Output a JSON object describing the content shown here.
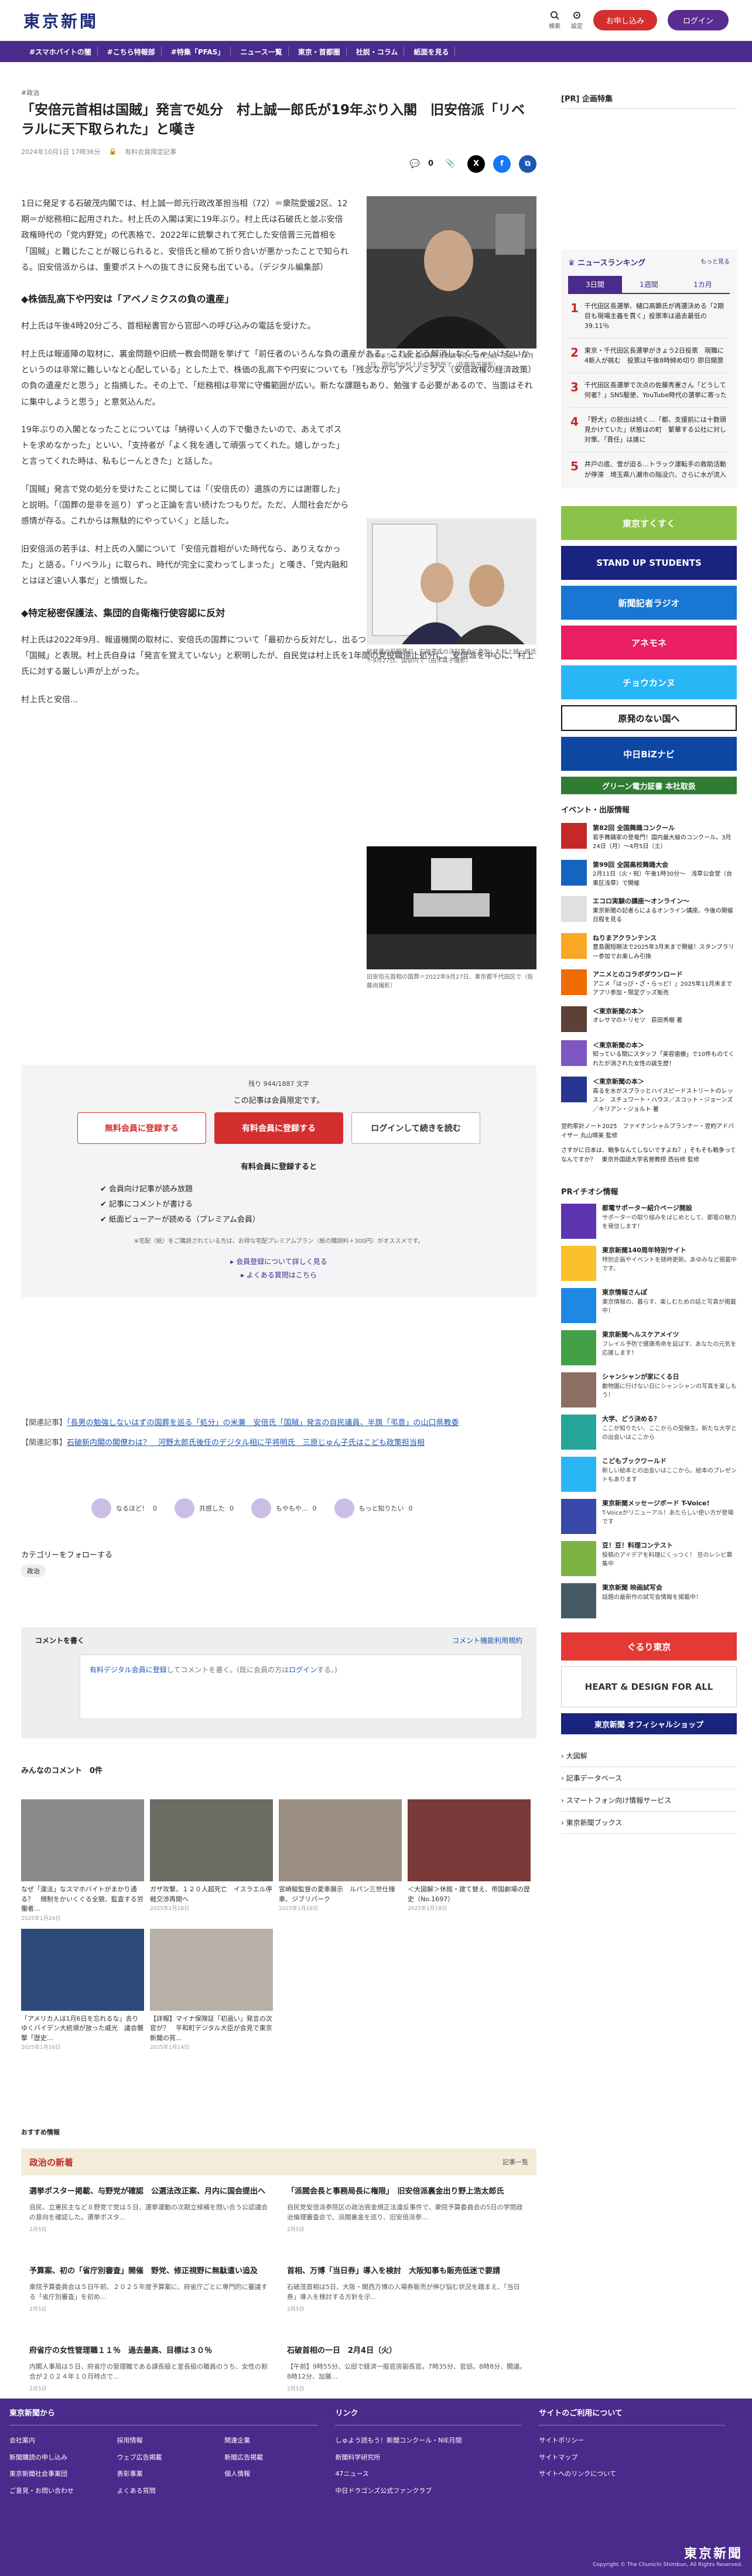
{
  "header": {
    "logo": "東京新聞",
    "search_label": "検索",
    "settings_label": "設定",
    "register_label": "お申し込み",
    "login_label": "ログイン"
  },
  "nav": [
    "#スマホバイトの闇",
    "#こちら特報部",
    "#特集「PFAS」",
    "ニュース一覧",
    "東京・首都圏",
    "社説・コラム",
    "紙面を見る"
  ],
  "article": {
    "category": "#政治",
    "title": "「安倍元首相は国賊」発言で処分　村上誠一郎氏が19年ぶり入閣　旧安倍派「リベラルに天下取られた」と嘆き",
    "date": "2024年10月1日 17時36分",
    "badge": "有料会員限定記事",
    "comment_count": "0",
    "p1": "1日に発足する石破茂内閣では、村上誠一郎元行政改革担当相（72）＝衆院愛媛2区、12期＝が総務相に起用された。村上氏の入閣は実に19年ぶり。村上氏は石破氏と並ぶ安倍政権時代の「党内野党」の代表格で、2022年に銃撃されて死亡した安倍晋三元首相を「国賊」と難じたことが報じられると、安倍氏と極めて折り合いが悪かったことで知られる。旧安倍派からは、重要ポストへの抜てきに反発も出ている。（デジタル編集部）",
    "h1": "◆株価乱高下や円安は「アベノミクスの負の遺産」",
    "p2": "村上氏は午後4時20分ごろ、首相秘書官から官邸への呼び込みの電話を受けた。",
    "p3": "村上氏は報道陣の取材に、裏金問題や旧統一教会問題を挙げて「前任者のいろんな負の遺産がある。これをどう解消しなくちゃいけないかというのは非常に難しいなと心配している」とした上で、株価の乱高下や円安についても「残念ながらアベノミクス（安倍政権の経済政策）の負の遺産だと思う」と指摘した。その上で、「総務相は非常に守備範囲が広い。新たな課題もあり、勉強する必要があるので、当面はそれに集中しようと思う」と意気込んだ。",
    "p4": "19年ぶりの入閣となったことについては「納得いく人の下で働きたいので、あえてポストを求めなかった」といい、「支持者が「よく我を通して頑張ってくれた。嬉しかった」と言ってくれた時は、私もじーんときた」と話した。",
    "p5": "「国賊」発言で党の処分を受けたことに関しては「（安倍氏の）遺族の方には謝罪した」と説明。「（国葬の是非を巡り）ずっと正論を言い続けたつもりだ。ただ、人間社会だから感情が存る。これからは無駄的にやっていく」と話した。",
    "p6": "旧安倍派の若手は、村上氏の入閣について「安倍元首相がいた時代なら、ありえなかった」と語る。「リベラル」に取られ、時代が完全に変わってしまった」と嘆き、「党内融和とはほど遠い人事だ」と憤慨した。",
    "h2": "◆特定秘密保護法、集団的自衛権行使容認に反対",
    "p7": "村上氏は2022年9月、報道機関の取材に、安倍氏の国葬について「最初から反対だし、出るつもりもない」との考えを示した際、安倍氏を「国賊」と表現。村上氏自身は「発言を覚えていない」と釈明したが、自民党は村上氏を1年間の党役職停止処分に。安倍派を中心に、村上氏に対する厳しい声が上がった。",
    "p8": "村上氏と安倍...",
    "fig1_cap": "19年ぶりの入閣に感慨深った表情を見せる村上誠一郎氏＝10月1日、国会内の村上氏の事務所で（佐藤哉平撮影）",
    "fig2_cap": "総裁選の投開票日、石破茂氏の決起集会に参加した村上誠一郎氏＝9月27日、国会内で（由木真子撮影）",
    "fig3_cap": "旧安倍元首相の国葬＝2022年9月27日、東京都千代田区で（佐藤尚撮影）"
  },
  "paywall": {
    "remaining": "残り 944/1887 文字",
    "lead": "この記事は会員限定です。",
    "btn_free": "無料会員に登録する",
    "btn_paid": "有料会員に登録する",
    "btn_login": "ログインして続きを読む",
    "subhead": "有料会員に登録すると",
    "benefits": [
      "会員向け記事が読み放題",
      "記事にコメントが書ける",
      "紙面ビューアーが読める（プレミアム会員）"
    ],
    "note": "※宅配（紙）をご購読されている方は、お得な宅配プレミアムプラン（紙の購読料＋300円）がオススメです。",
    "link1": "会員登録について詳しく見る",
    "link2": "よくある質問はこちら"
  },
  "related": [
    {
      "label": "【関連記事】",
      "text": "「長男の勉強しないはずの国葬を巡る「処分」の米兼　安倍氏「国賊」発言の自民議員、半旗「弔意」の山口県教委"
    },
    {
      "label": "【関連記事】",
      "text": "石破新内閣の閣僚わは？　河野太郎氏後任のデジタル相に平将明氏　三原じゅん子氏はこども政策担当相"
    }
  ],
  "reactions": [
    "なるほど！",
    "共感した",
    "もやもや...",
    "もっと知りたい"
  ],
  "reaction_counts": [
    "0",
    "0",
    "0",
    "0"
  ],
  "follow": {
    "label": "カテゴリーをフォローする",
    "chip": "政治"
  },
  "comment": {
    "title": "コメントを書く",
    "rule": "コメント機能利用規約",
    "prompt_link": "有料デジタル会員に登録",
    "prompt": "してコメントを書く。(既に会員の方は",
    "login": "ログイン",
    "prompt_end": "する。)"
  },
  "comments_title": "みんなのコメント　0件",
  "thumbs": [
    {
      "cap": "なぜ「違法」なスマホバイトがまかり通る？　規制をかいくぐる全貌、監査する労働者...",
      "date": "2025年1月24日"
    },
    {
      "cap": "ガザ攻撃、１２０人超死亡　イスラエル停戦交渉再開へ",
      "date": "2025年1月18日"
    },
    {
      "cap": "宮崎駿監督の愛車展示　ルパン三世仕様車、ジブリパーク",
      "date": "2025年1月16日"
    },
    {
      "cap": "＜大図解＞休館・建て替え、帝国劇場の歴史（No.1697）",
      "date": "2025年1月18日"
    },
    {
      "cap": "「アメリカ人は1月6日を忘れるな」去りゆくバイデン大統領が放った威光　議会襲撃「歴史...",
      "date": "2025年1月16日"
    },
    {
      "cap": "【詳報】マイナ保険証「初過い」発言の次官が？　平和町デジタル大臣が会見で東京新聞の質...",
      "date": "2025年1月14日"
    }
  ],
  "recommend": "おすすめ情報",
  "politics": {
    "head": "政治の新着",
    "more": "記事一覧",
    "items": [
      {
        "t": "選挙ポスター掲載、与野党が確認　公選法改正案、月内に国会提出へ",
        "d": "自民、立憲民主など８野党で党は５日、選挙運動の次期立候補を問い合う公認議会の意向を確認した。選挙ポスタ...",
        "dt": "2月5日"
      },
      {
        "t": "「派閥会長と事務局長に権限」　旧安倍派裏金出り野上浩太郎氏",
        "d": "自民党安倍派参院区の政治資金規正法違反事件で、衆院予算委員会の5日の学問政治倫理審査会で、派閥裏金を巡り、旧安倍派参...",
        "dt": "2月5日"
      },
      {
        "t": "予算案、初の「省庁別審査」開催　野党、修正視野に無駄遣い追及",
        "d": "衆院予算委員会は５日午前、２０２５年度予算案に、府省庁ごとに専門的に審議する「省庁別審査」を初め...",
        "dt": "2月5日"
      },
      {
        "t": "首相、万博「当日券」導入を検討　大阪知事も販売低迷で要請",
        "d": "石破茂首相は5日、大阪・関西万博の入場券販売が伸び悩む状況を踏まえ、「当日券」導入を検討する方針を示...",
        "dt": "2月5日"
      },
      {
        "t": "府省庁の女性管理職１１％　過去最高、目標は３０％",
        "d": "内閣人事局は５日、府省庁の管理職である課長級と室長級の職員のうち、女性の割合が２０２４年１０月時点で...",
        "dt": "2月5日"
      },
      {
        "t": "石破首相の一日　2月4日（火）",
        "d": "【午前】9時55分、公邸で経済一般官房副長官。7時35分、官邸。8時8分、閣議。8時12分、加藤...",
        "dt": "2月5日"
      }
    ]
  },
  "sidebar": {
    "pr_head": "[PR] 企画特集",
    "ranking_title": "ニュースランキング",
    "ranking_more": "もっと見る",
    "tabs": [
      "3日間",
      "1週間",
      "1カ月"
    ],
    "ranking": [
      {
        "n": "1",
        "t": "千代田区長選挙、樋口高顕氏が再選決める「2期目も現場主義を貫く」投票率は過去最低の39.11％"
      },
      {
        "n": "2",
        "t": "東京・千代田区長選挙がきょう2日投票　現職に4新人が挑む　投票は午後8時締め切り 即日開票"
      },
      {
        "n": "3",
        "t": "千代田区長選挙で次点の佐藤秀憲さん「どうして何者？」SNS駆使、YouTube時代の選挙に寄った"
      },
      {
        "n": "4",
        "t": "「野犬」の脱出は続く…「都、支援前には十数頭見かけていた」状態はの町　繁華する公社に対し対策、「責任」は誰に"
      },
      {
        "n": "5",
        "t": "井戸の底、雪が迫る…トラック運転手の救助活動が停滞　埼玉県八潮市の陥没穴、さらに水が流入"
      }
    ],
    "banners": [
      "東京すくすく",
      "STAND UP STUDENTS",
      "新聞記者ラジオ",
      "アネモネ",
      "チョウカンヌ",
      "原発のない国へ",
      "中日BiZナビ",
      "グリーン電力証書 本社取扱"
    ],
    "events_title": "イベント・出版情報",
    "events": [
      {
        "t": "第82回 全国舞踊コンクール",
        "d": "若手舞踊家の登竜門！国内最大級のコンクール。3月24日（月）～4月5日（土）"
      },
      {
        "t": "第99回 全国高校舞踊大会",
        "d": "2月11日（火・祝）午後1時30分～　浅草公会堂（台東区浅草）で開催"
      },
      {
        "t": "エコロ実験の講座〜オンライン〜",
        "d": "東京新聞の記者らによるオンライン講座。今後の開催日程を見る"
      },
      {
        "t": "ねりまアクランテンス",
        "d": "豊島園短期法で2025年3月末まで開催！スタンプラリー参加でお楽しみ引換"
      },
      {
        "t": "アニメとのコラボダウンロード",
        "d": "アニメ「はっぴ・ざ・らっど！」2025年11月末までアプリ参加・限定グッズ販売"
      },
      {
        "t": "＜東京新聞の本＞",
        "d": "オレサマのトリセツ　荻田秀樹 著"
      },
      {
        "t": "＜東京新聞の本＞",
        "d": "知っている間にスタッフ「美容歯療」で10件ものてくれたが消された女性の誕生歴！"
      },
      {
        "t": "＜東京新聞の本＞",
        "d": "高るを水がスプラッとハイスピードストリートのレッスン　スチュワート・ハウス／スコット・ジョーンズ／キリアン・ジョルト 著"
      }
    ],
    "ev_extra": "翌約家計ノート2025　ファイナンシャルプランナー・翌約アドバイザー 丸山晴美 監修",
    "ev_extra2": "さすがに日本は、戦争なんてしないですよね？」そもそも戦争ってなんですか？　東京外国語大学名誉教授 西谷修 監修",
    "pr2_title": "PRイチオシ情報",
    "pr2": [
      {
        "t": "都電サポーター紹介ページ開設",
        "d": "サポーターの取り組みをはじめとして、都電の魅力を発信します！"
      },
      {
        "t": "東京新聞140周年特別サイト",
        "d": "特別企画やイベントを随時更新。あゆみなど掲載中です。"
      },
      {
        "t": "東京情報さんぽ",
        "d": "東京情報の、暮らす、楽しむための話と写真が掲載中！"
      },
      {
        "t": "東京新聞ヘルスケアメイツ",
        "d": "フレイル予防で健康寿命を延ばす、あなたの元気を応援します！"
      },
      {
        "t": "シャンシャンが家にくる日",
        "d": "動物園に行けない日にシャンシャンの写真を楽しもう！"
      },
      {
        "t": "大学、どう決める？",
        "d": "ここが知りたい、ここからの受験生。新たな大学との出会いはここから"
      },
      {
        "t": "こどもブックワールド",
        "d": "新しい絵本との出会いはここから。絵本のプレゼントもあります"
      },
      {
        "t": "東京新聞メッセージボード T-Voice!",
        "d": "T-Voiceがリニューアル！あたらしい使い方が登場です"
      },
      {
        "t": "豆！豆！料理コンテスト",
        "d": "投稿のアイデアを料理にくっつく！ 豆のレシピ募集中"
      },
      {
        "t": "東京新聞 映画試写会",
        "d": "話題の最新作の試写会情報を掲載中！"
      }
    ],
    "side_banners": [
      "ぐるり東京",
      "HEART & DESIGN FOR ALL",
      "東京新聞 オフィシャルショップ"
    ],
    "side_links": [
      "大図解",
      "記事データベース",
      "スマートフォン向け情報サービス",
      "東京新聞ブックス"
    ]
  },
  "footer": {
    "cols": [
      {
        "h": "東京新聞から",
        "links": [
          "会社案内",
          "採用情報",
          "関連企業",
          "新聞購読の申し込み",
          "ウェブ広告掲載",
          "新聞広告掲載",
          "東京新聞社会事業団",
          "表彰事業",
          "個人情報",
          "ご意見・お問い合わせ",
          "よくある質問",
          ""
        ]
      },
      {
        "h": "リンク",
        "links": [
          "しゅよう読もう！新聞コンクール・NIE月間",
          "新聞科学研究所",
          "47ニュース",
          "中日ドラゴンズ公式ファンクラブ"
        ]
      },
      {
        "h": "サイトのご利用について",
        "links": [
          "サイトポリシー",
          "サイトマップ",
          "サイトへのリンクについて"
        ]
      }
    ],
    "logo": "東京新聞",
    "copy": "Copyright © The Chunichi Shimbun, All Rights Reserved."
  }
}
